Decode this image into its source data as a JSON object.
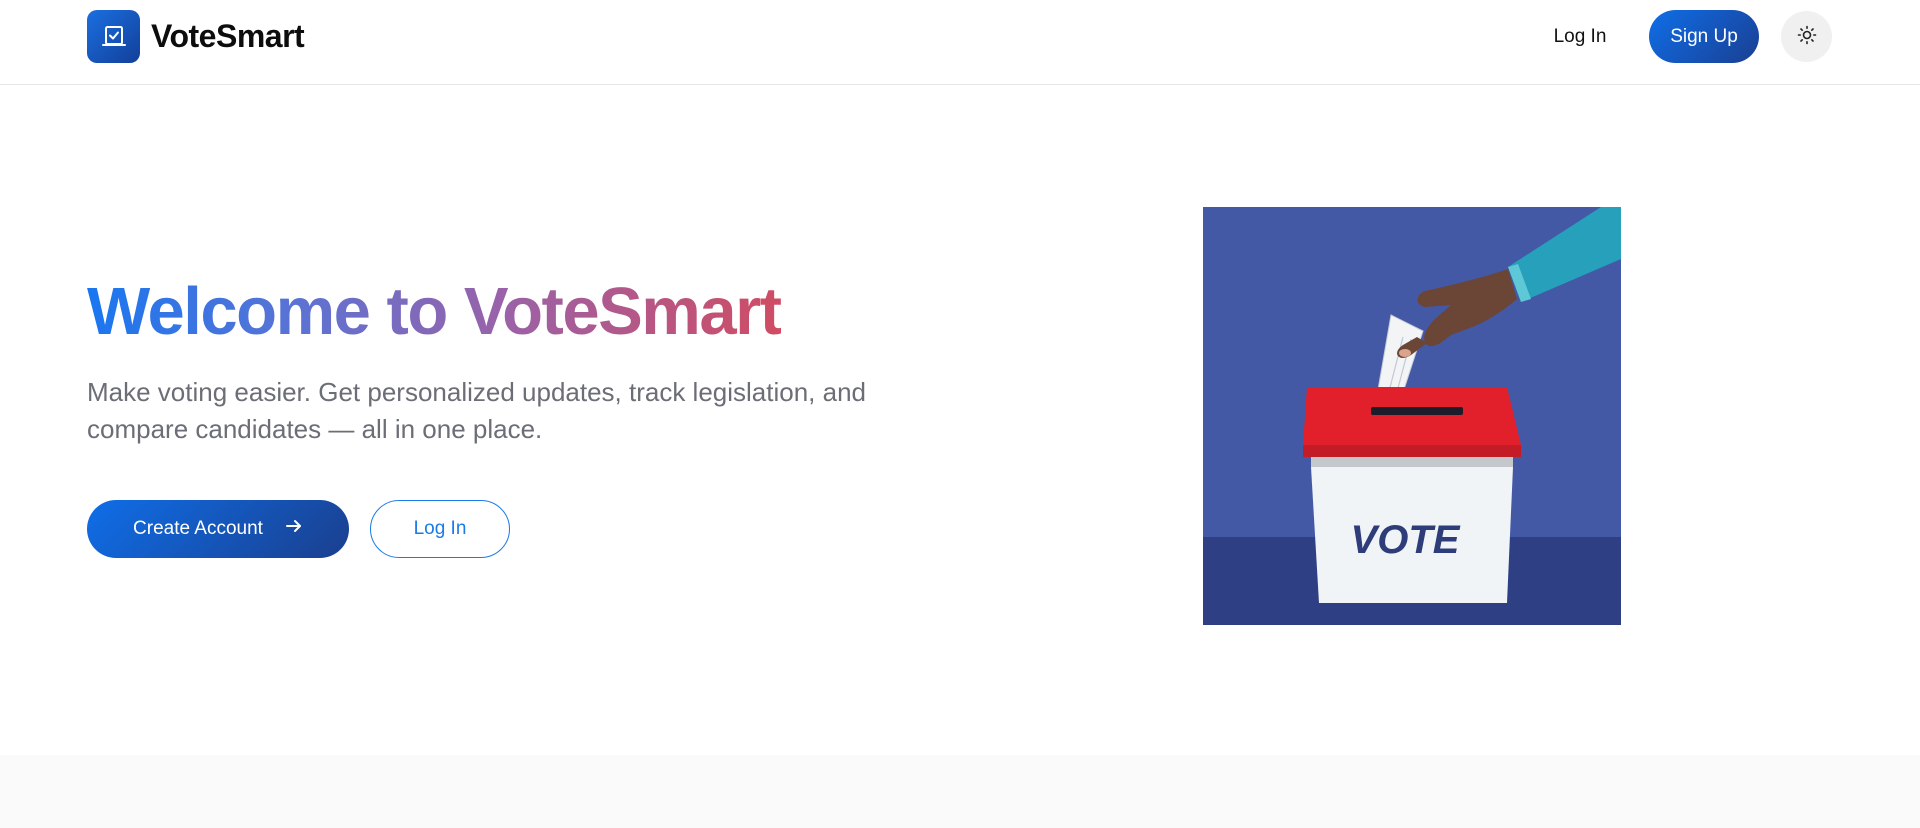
{
  "header": {
    "brand_name": "VoteSmart",
    "login_label": "Log In",
    "signup_label": "Sign Up"
  },
  "hero": {
    "title": "Welcome to VoteSmart",
    "subtitle": "Make voting easier. Get personalized updates, track legislation, and compare candidates — all in one place.",
    "create_account_label": "Create Account",
    "login_label": "Log In",
    "illustration_text": "VOTE"
  },
  "icons": {
    "logo": "ballot-check-icon",
    "theme_toggle": "sun-icon",
    "create_account_arrow": "arrow-right-icon"
  },
  "colors": {
    "primary": "#0f6ee8",
    "primary_dark": "#1a3f8e",
    "title_gradient": [
      "#1976f0",
      "#9a62a8",
      "#d04c63"
    ],
    "illustration_bg": "#4459a6",
    "ballot_box_lid": "#e2202c"
  }
}
